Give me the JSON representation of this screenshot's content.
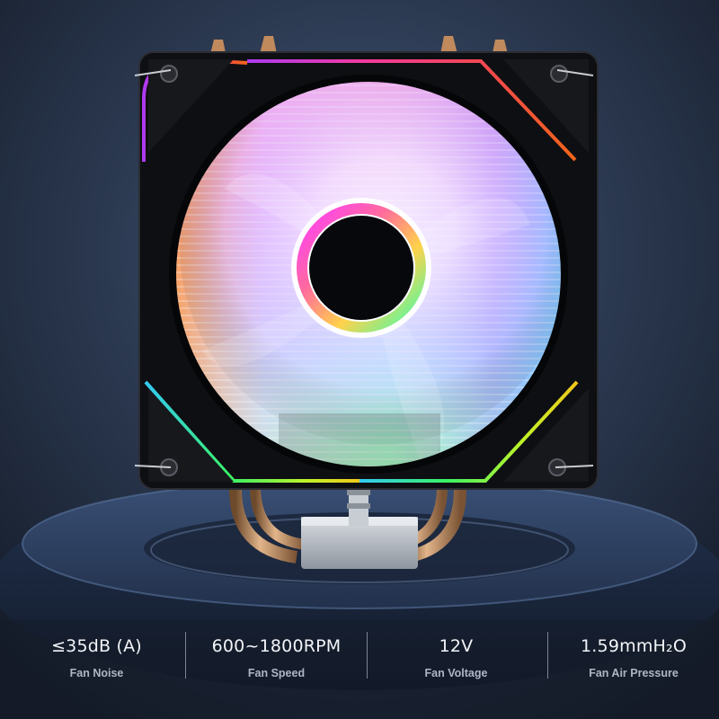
{
  "product_image": {
    "colors": {
      "background": "#1c2434",
      "fan_frame": "#111214",
      "pedestal": "#2a3a57",
      "heatpipe": "#b98a5f"
    }
  },
  "specs": [
    {
      "value": "≤35dB (A)",
      "label": "Fan Noise"
    },
    {
      "value": "600~1800RPM",
      "label": "Fan Speed"
    },
    {
      "value": "12V",
      "label": "Fan Voltage"
    },
    {
      "value": "1.59mmH₂O",
      "label": "Fan Air Pressure"
    }
  ]
}
